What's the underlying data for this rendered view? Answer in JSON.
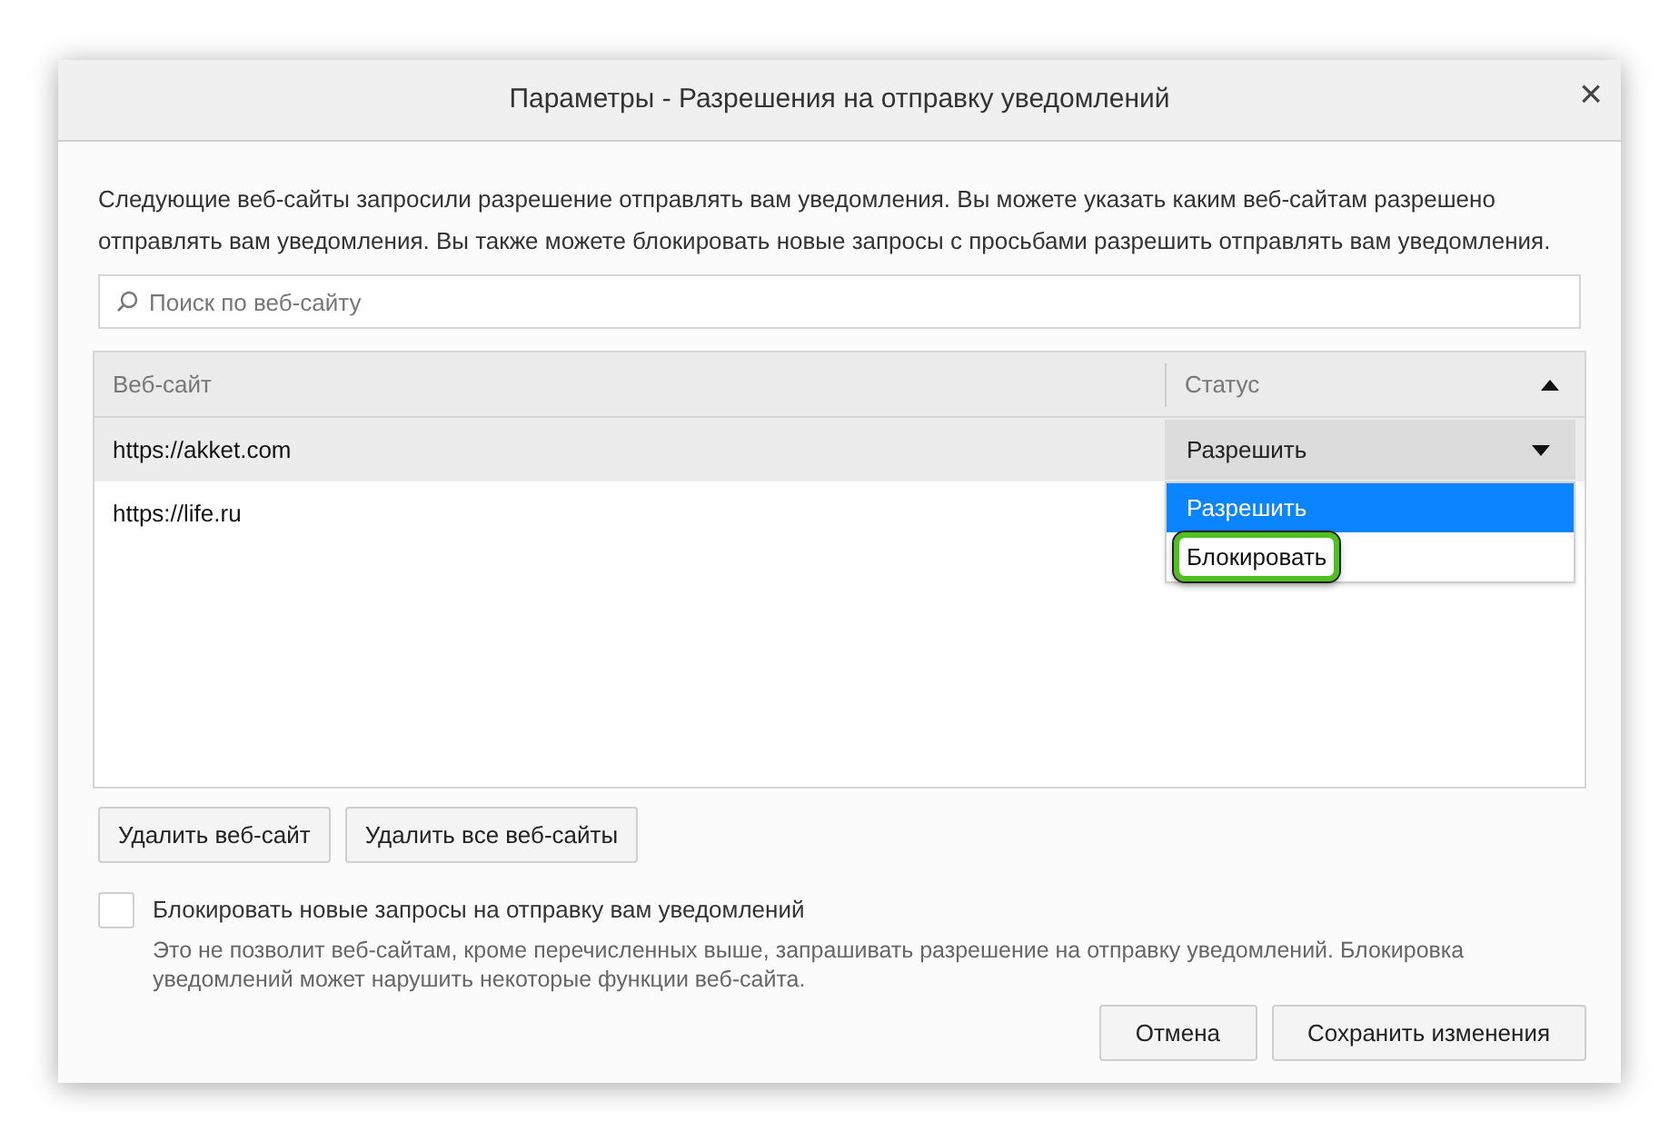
{
  "window": {
    "title": "Параметры - Разрешения на отправку уведомлений",
    "close": "×"
  },
  "description": "Следующие веб-сайты запросили разрешение отправлять вам уведомления. Вы можете указать каким веб-сайтам разрешено отправлять вам уведомления. Вы также можете блокировать новые запросы с просьбами разрешить отправлять вам уведомления.",
  "search": {
    "placeholder": "Поиск по веб-сайту"
  },
  "table": {
    "columns": [
      {
        "label": "Веб-сайт"
      },
      {
        "label": "Статус",
        "sorted_ascending": true
      }
    ],
    "rows": [
      {
        "site": "https://akket.com",
        "selected": true,
        "status": "Разрешить",
        "dropdown_open": true
      },
      {
        "site": "https://life.ru",
        "selected": false
      }
    ]
  },
  "dropdown_options": [
    {
      "label": "Разрешить",
      "selected": true,
      "highlighted": false
    },
    {
      "label": "Блокировать",
      "selected": false,
      "highlighted": true
    }
  ],
  "buttons": [
    "Удалить веб-сайт",
    "Удалить все веб-сайты"
  ],
  "block_option": {
    "label": "Блокировать новые запросы на отправку вам уведомлений",
    "checked": false,
    "note": "Это не позволит веб-сайтам, кроме перечисленных выше, запрашивать разрешение на отправку уведомлений. Блокировка уведомлений может нарушить некоторые функции веб-сайта."
  },
  "footer_buttons": [
    "Отмена",
    "Сохранить изменения"
  ]
}
